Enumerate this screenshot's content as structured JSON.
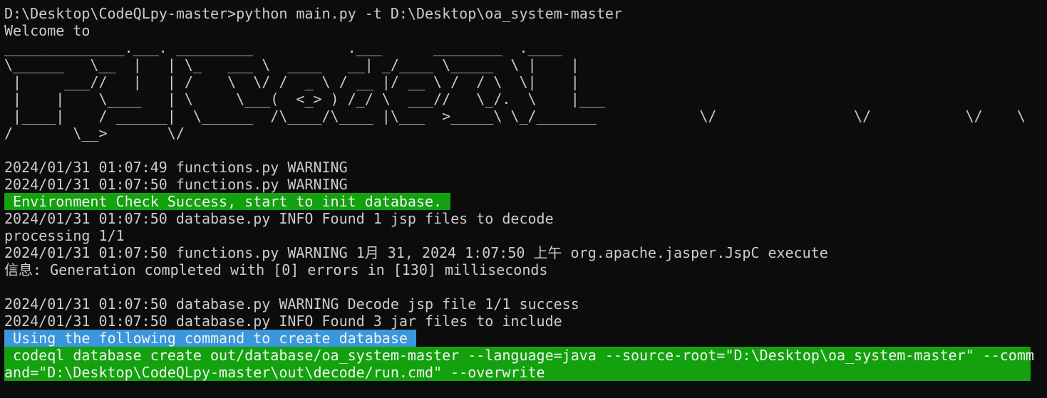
{
  "theme": {
    "background": "#0c0c0c",
    "text": "#cccccc",
    "green_highlight": "#13a10e",
    "blue_highlight": "#3a96dd"
  },
  "terminal": {
    "command_line": "D:\\Desktop\\CodeQLpy-master>python main.py -t D:\\Desktop\\oa_system-master",
    "welcome": "Welcome to",
    "banner_lines": [
      "______________.___. _________           .___      ________  .____",
      "\\______   \\__  |   | \\_   ___ \\  ____   __| _/____ \\_____  \\ |    |",
      " |     ___//   |   | /    \\  \\/ /  _ \\ / __ |/ __ \\ /  / \\  \\|    |",
      " |    |    \\____   | \\     \\___(  <_> ) /_/ \\  ___//   \\_/.  \\    |___",
      " |____|    / ______|  \\______  /\\____/\\____ |\\___  >_____\\ \\_/_______            \\/                \\/           \\/    \\",
      "/       \\__>       \\/"
    ],
    "blank": "",
    "log_1": "2024/01/31 01:07:49 functions.py WARNING",
    "log_2": "2024/01/31 01:07:50 functions.py WARNING",
    "env_check": " Environment Check Success, start to init database. ",
    "log_3": "2024/01/31 01:07:50 database.py INFO Found 1 jsp files to decode",
    "processing": "processing 1/1",
    "log_4": "2024/01/31 01:07:50 functions.py WARNING 1月 31, 2024 1:07:50 上午 org.apache.jasper.JspC execute",
    "info_line": "信息: Generation completed with [0] errors in [130] milliseconds",
    "log_5": "2024/01/31 01:07:50 database.py WARNING Decode jsp file 1/1 success",
    "log_6": "2024/01/31 01:07:50 database.py INFO Found 3 jar files to include",
    "using_cmd": " Using the following command to create database ",
    "codeql_line_1": " codeql database create out/database/oa_system-master --language=java --source-root=\"D:\\Desktop\\oa_system-master\" --comm",
    "codeql_line_2": "and=\"D:\\Desktop\\CodeQLpy-master\\out\\decode/run.cmd\" --overwrite"
  }
}
